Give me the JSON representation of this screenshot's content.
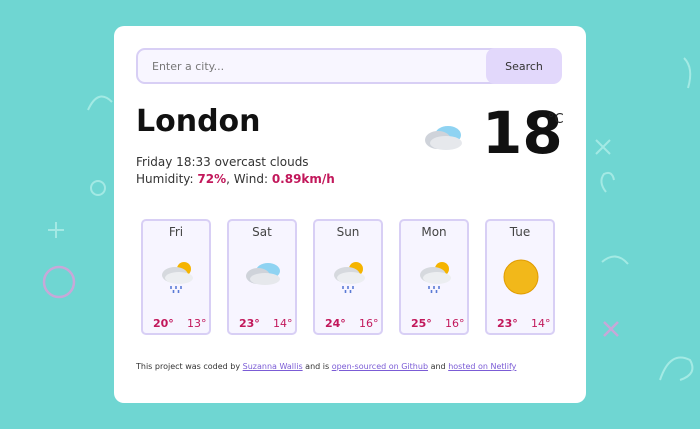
{
  "search": {
    "placeholder": "Enter a city...",
    "button_label": "Search"
  },
  "current": {
    "city": "London",
    "datetime": "Friday 18:33",
    "description": "overcast clouds",
    "humidity_label": "Humidity:",
    "humidity": "72%",
    "wind_label": "Wind:",
    "wind": "0.89km/h",
    "temperature": "18",
    "unit": "°C",
    "icon": "overcast-clouds-icon"
  },
  "forecast": [
    {
      "day": "Fri",
      "max": "20°",
      "min": "13°",
      "icon": "rain-sun-cloud-icon"
    },
    {
      "day": "Sat",
      "max": "23°",
      "min": "14°",
      "icon": "cloud-icon"
    },
    {
      "day": "Sun",
      "max": "24°",
      "min": "16°",
      "icon": "rain-sun-cloud-icon"
    },
    {
      "day": "Mon",
      "max": "25°",
      "min": "16°",
      "icon": "rain-sun-cloud-icon"
    },
    {
      "day": "Tue",
      "max": "23°",
      "min": "14°",
      "icon": "sun-icon"
    }
  ],
  "footer": {
    "prefix": "This project was coded by",
    "author": "Suzanna Wallis",
    "middle": "and is",
    "github_link": "open-sourced on Github",
    "and": "and",
    "netlify_link": "hosted on Netlify"
  },
  "colors": {
    "background": "#6fd6d2",
    "accent": "#c2185b",
    "link": "#7b5cd6",
    "button": "#e2d8fb"
  }
}
